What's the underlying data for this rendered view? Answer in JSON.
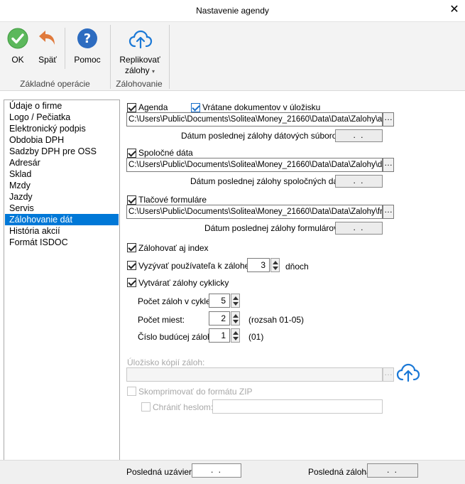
{
  "window": {
    "title": "Nastavenie agendy",
    "close_glyph": "✕"
  },
  "ribbon": {
    "buttons": {
      "ok": {
        "label": "OK",
        "icon": "check-circle-icon",
        "color": "#5cb85c"
      },
      "back": {
        "label": "Späť",
        "icon": "undo-icon",
        "color": "#e07a3c"
      },
      "help": {
        "label": "Pomoc",
        "icon": "question-circle-icon",
        "color": "#2d6cc0"
      },
      "replicate": {
        "label_line1": "Replikovať",
        "label_line2": "zálohy",
        "icon": "cloud-upload-icon",
        "color": "#1a78d6"
      }
    },
    "groups": {
      "basic": "Základné operácie",
      "backup": "Zálohovanie"
    }
  },
  "nav": {
    "items": [
      "Údaje o firme",
      "Logo / Pečiatka",
      "Elektronický podpis",
      "Obdobia DPH",
      "Sadzby DPH pre OSS",
      "Adresár",
      "Sklad",
      "Mzdy",
      "Jazdy",
      "Servis",
      "Zálohovanie dát",
      "História akcií",
      "Formát ISDOC"
    ],
    "selected_index": 10,
    "selected_color": "#0078d7"
  },
  "form": {
    "agenda": {
      "label": "Agenda",
      "checked": true,
      "include_docs_label": "Vrátane dokumentov v úložisku",
      "include_docs_checked": true,
      "path": "C:\\Users\\Public\\Documents\\Solitea\\Money_21660\\Data\\Data\\Zalohy\\agsp",
      "date_label": "Dátum poslednej zálohy dátových súborov:",
      "date_value": ". ."
    },
    "shared": {
      "label": "Spoločné dáta",
      "checked": true,
      "path": "C:\\Users\\Public\\Documents\\Solitea\\Money_21660\\Data\\Data\\Zalohy\\data",
      "date_label": "Dátum poslednej zálohy spoločných dát:",
      "date_value": ". ."
    },
    "print_forms": {
      "label": "Tlačové formuláre",
      "checked": true,
      "path": "C:\\Users\\Public\\Documents\\Solitea\\Money_21660\\Data\\Data\\Zalohy\\frm.l",
      "date_label": "Dátum poslednej zálohy formulárov:",
      "date_value": ". ."
    },
    "backup_index": {
      "label": "Zálohovať aj index",
      "checked": true
    },
    "prompt_user": {
      "label_prefix": "Vyzývať používateľa k zálohe po",
      "value": "3",
      "label_suffix": "dňoch",
      "checked": true
    },
    "cyclic": {
      "label": "Vytvárať zálohy cyklicky",
      "checked": true,
      "count_label": "Počet záloh v cykle:",
      "count_value": "5",
      "places_label": "Počet miest:",
      "places_value": "2",
      "places_hint": "(rozsah 01-05)",
      "next_label": "Číslo budúcej zálohy:",
      "next_value": "1",
      "next_hint": "(01)"
    },
    "copy_storage": {
      "label": "Úložisko kópií záloh:",
      "path": "",
      "cloud_icon": "cloud-upload-icon"
    },
    "zip": {
      "label": "Skomprimovať do formátu ZIP",
      "checked": false
    },
    "password": {
      "label": "Chrániť heslom:",
      "checked": false,
      "value": ""
    }
  },
  "bottom": {
    "last_closing_label": "Posledná uzávierka",
    "last_closing_value": ". .",
    "last_backup_label": "Posledná záloha:",
    "last_backup_value": ". ."
  }
}
